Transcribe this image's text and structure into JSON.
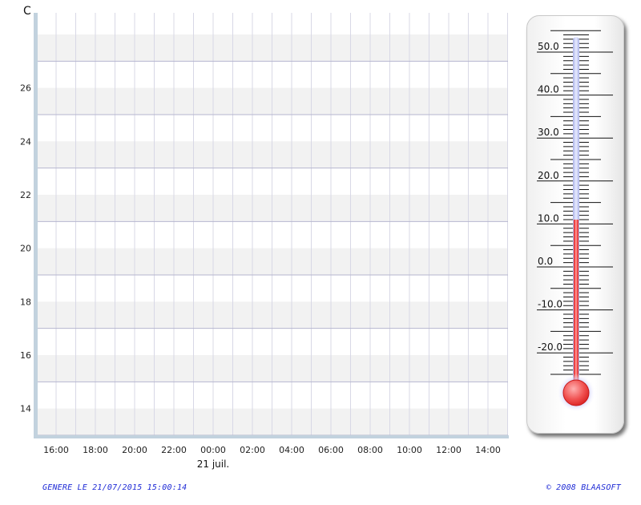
{
  "chart_data": {
    "type": "line",
    "unit": "C",
    "ylim": [
      13,
      28
    ],
    "y_ticks": [
      14,
      16,
      18,
      20,
      22,
      24,
      26
    ],
    "x_ticks": [
      "16:00",
      "18:00",
      "20:00",
      "22:00",
      "00:00",
      "02:00",
      "04:00",
      "06:00",
      "08:00",
      "10:00",
      "12:00",
      "14:00"
    ],
    "date_marker": "21 juil.",
    "grid": true,
    "series": []
  },
  "thermometer": {
    "value": 11,
    "range": [
      -25,
      55
    ],
    "labels": [
      "50.0",
      "40.0",
      "30.0",
      "20.0",
      "10.0",
      "0.0",
      "-10.0",
      "-20.0"
    ],
    "label_values": [
      50,
      40,
      30,
      20,
      10,
      0,
      -10,
      -20
    ],
    "fill_color": "#ee2b2b",
    "tube_color": "#c8cdf0"
  },
  "footer": {
    "left": "GENERE LE 21/07/2015 15:00:14",
    "right": "© 2008 BLAASOFT"
  },
  "colors": {
    "band": "#f2f2f2",
    "grid": "#b6b6cf",
    "axis": "#c2d2de"
  }
}
